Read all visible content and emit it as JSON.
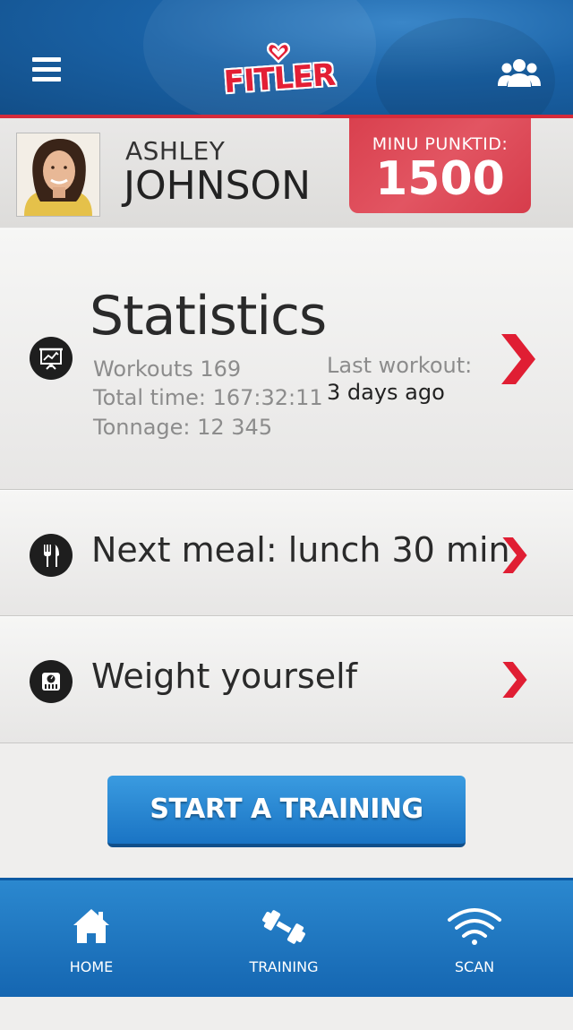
{
  "header": {
    "logo_text": "FITLER"
  },
  "profile": {
    "first_name": "ASHLEY",
    "last_name": "JOHNSON",
    "points_label": "MINU PUNKTID:",
    "points_value": "1500"
  },
  "statistics": {
    "title": "Statistics",
    "workouts": "Workouts 169",
    "total_time": "Total time: 167:32:11",
    "tonnage": "Tonnage: 12 345",
    "last_workout_label": "Last workout:",
    "last_workout_value": "3 days ago"
  },
  "meal": {
    "label": "Next meal: lunch 30 min"
  },
  "weight": {
    "label": "Weight yourself"
  },
  "start_button": {
    "label": "START A TRAINING"
  },
  "bottom_nav": {
    "items": [
      {
        "label": "HOME",
        "icon": "home-icon"
      },
      {
        "label": "TRAINING",
        "icon": "dumbbell-icon"
      },
      {
        "label": "SCAN",
        "icon": "wifi-icon"
      }
    ]
  },
  "colors": {
    "brand_blue": "#1a62a6",
    "accent_red": "#e31f35",
    "points_red": "#d9404e"
  }
}
